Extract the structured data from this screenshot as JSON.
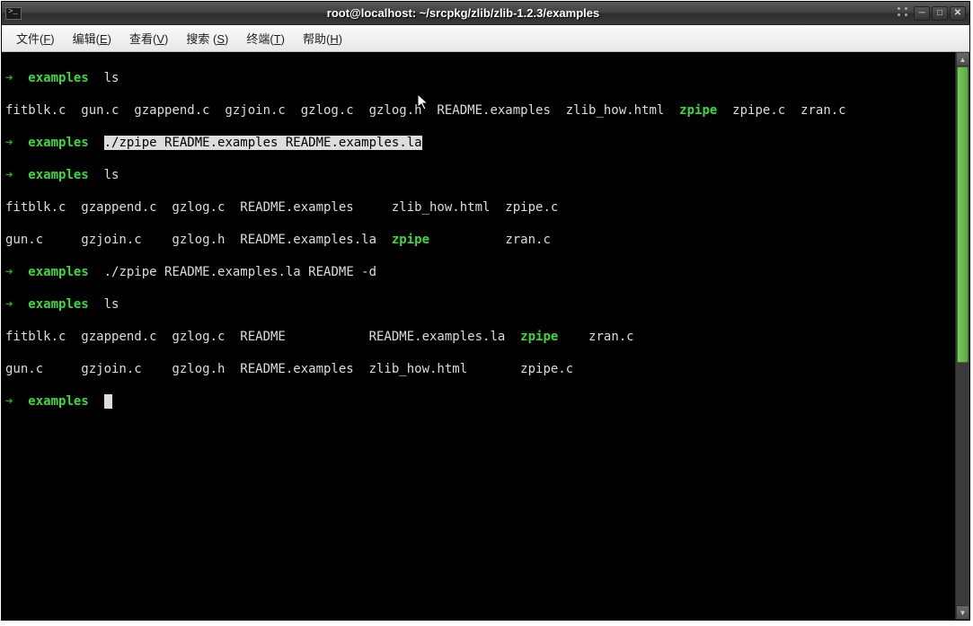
{
  "window": {
    "title": "root@localhost: ~/srcpkg/zlib/zlib-1.2.3/examples"
  },
  "menu": {
    "file": "文件(",
    "file_u": "F",
    "file_end": ")",
    "edit": "编辑(",
    "edit_u": "E",
    "edit_end": ")",
    "view": "查看(",
    "view_u": "V",
    "view_end": ")",
    "search": "搜索 (",
    "search_u": "S",
    "search_end": ")",
    "terminal": "终端(",
    "terminal_u": "T",
    "terminal_end": ")",
    "help": "帮助(",
    "help_u": "H",
    "help_end": ")"
  },
  "terminal": {
    "arrow": "➜",
    "dir": "examples",
    "cmd_ls": "ls",
    "ls1_a": "fitblk.c  gun.c  gzappend.c  gzjoin.c  gzlog.c  gzlog.h  README.examples  zlib_how.html  ",
    "ls1_zpipe": "zpipe",
    "ls1_b": "  zpipe.c  zran.c",
    "cmd2_hl": "./zpipe README.examples README.examples.la",
    "ls2_r1a": "fitblk.c  gzappend.c  gzlog.c  README.examples     zlib_how.html  zpipe.c",
    "ls2_r2a": "gun.c     gzjoin.c    gzlog.h  README.examples.la  ",
    "ls2_zpipe": "zpipe",
    "ls2_r2b": "          zran.c",
    "cmd4": "./zpipe README.examples.la README -d",
    "ls3_r1a": "fitblk.c  gzappend.c  gzlog.c  README           README.examples.la  ",
    "ls3_zpipe": "zpipe",
    "ls3_r1b": "    zran.c",
    "ls3_r2": "gun.c     gzjoin.c    gzlog.h  README.examples  zlib_how.html       zpipe.c"
  }
}
